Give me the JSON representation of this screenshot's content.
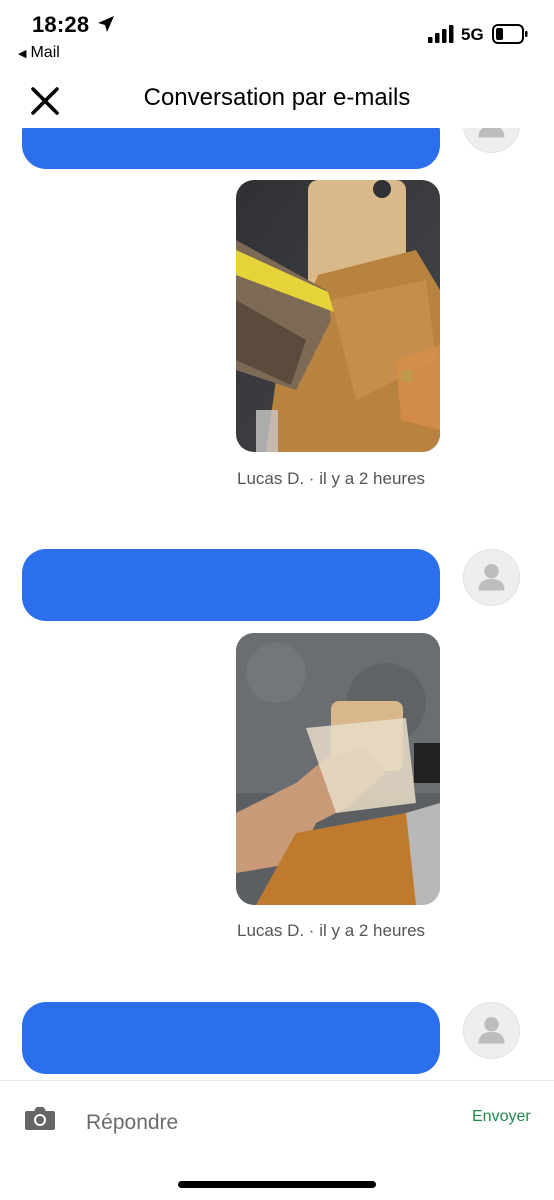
{
  "status_bar": {
    "time": "18:28",
    "back_app": "Mail",
    "network": "5G"
  },
  "header": {
    "title": "Conversation par e-mails"
  },
  "messages": [
    {
      "meta": "Lucas D. · il y a 2 heures"
    },
    {
      "meta": "Lucas D. · il y a 2 heures"
    }
  ],
  "footer": {
    "reply_placeholder": "Répondre",
    "send_label": "Envoyer"
  },
  "colors": {
    "bubble": "#2b6fec",
    "send": "#1f8a47"
  },
  "icons": [
    "location-arrow-icon",
    "back-triangle-icon",
    "signal-icon",
    "battery-icon",
    "close-icon",
    "avatar-icon",
    "camera-icon"
  ]
}
